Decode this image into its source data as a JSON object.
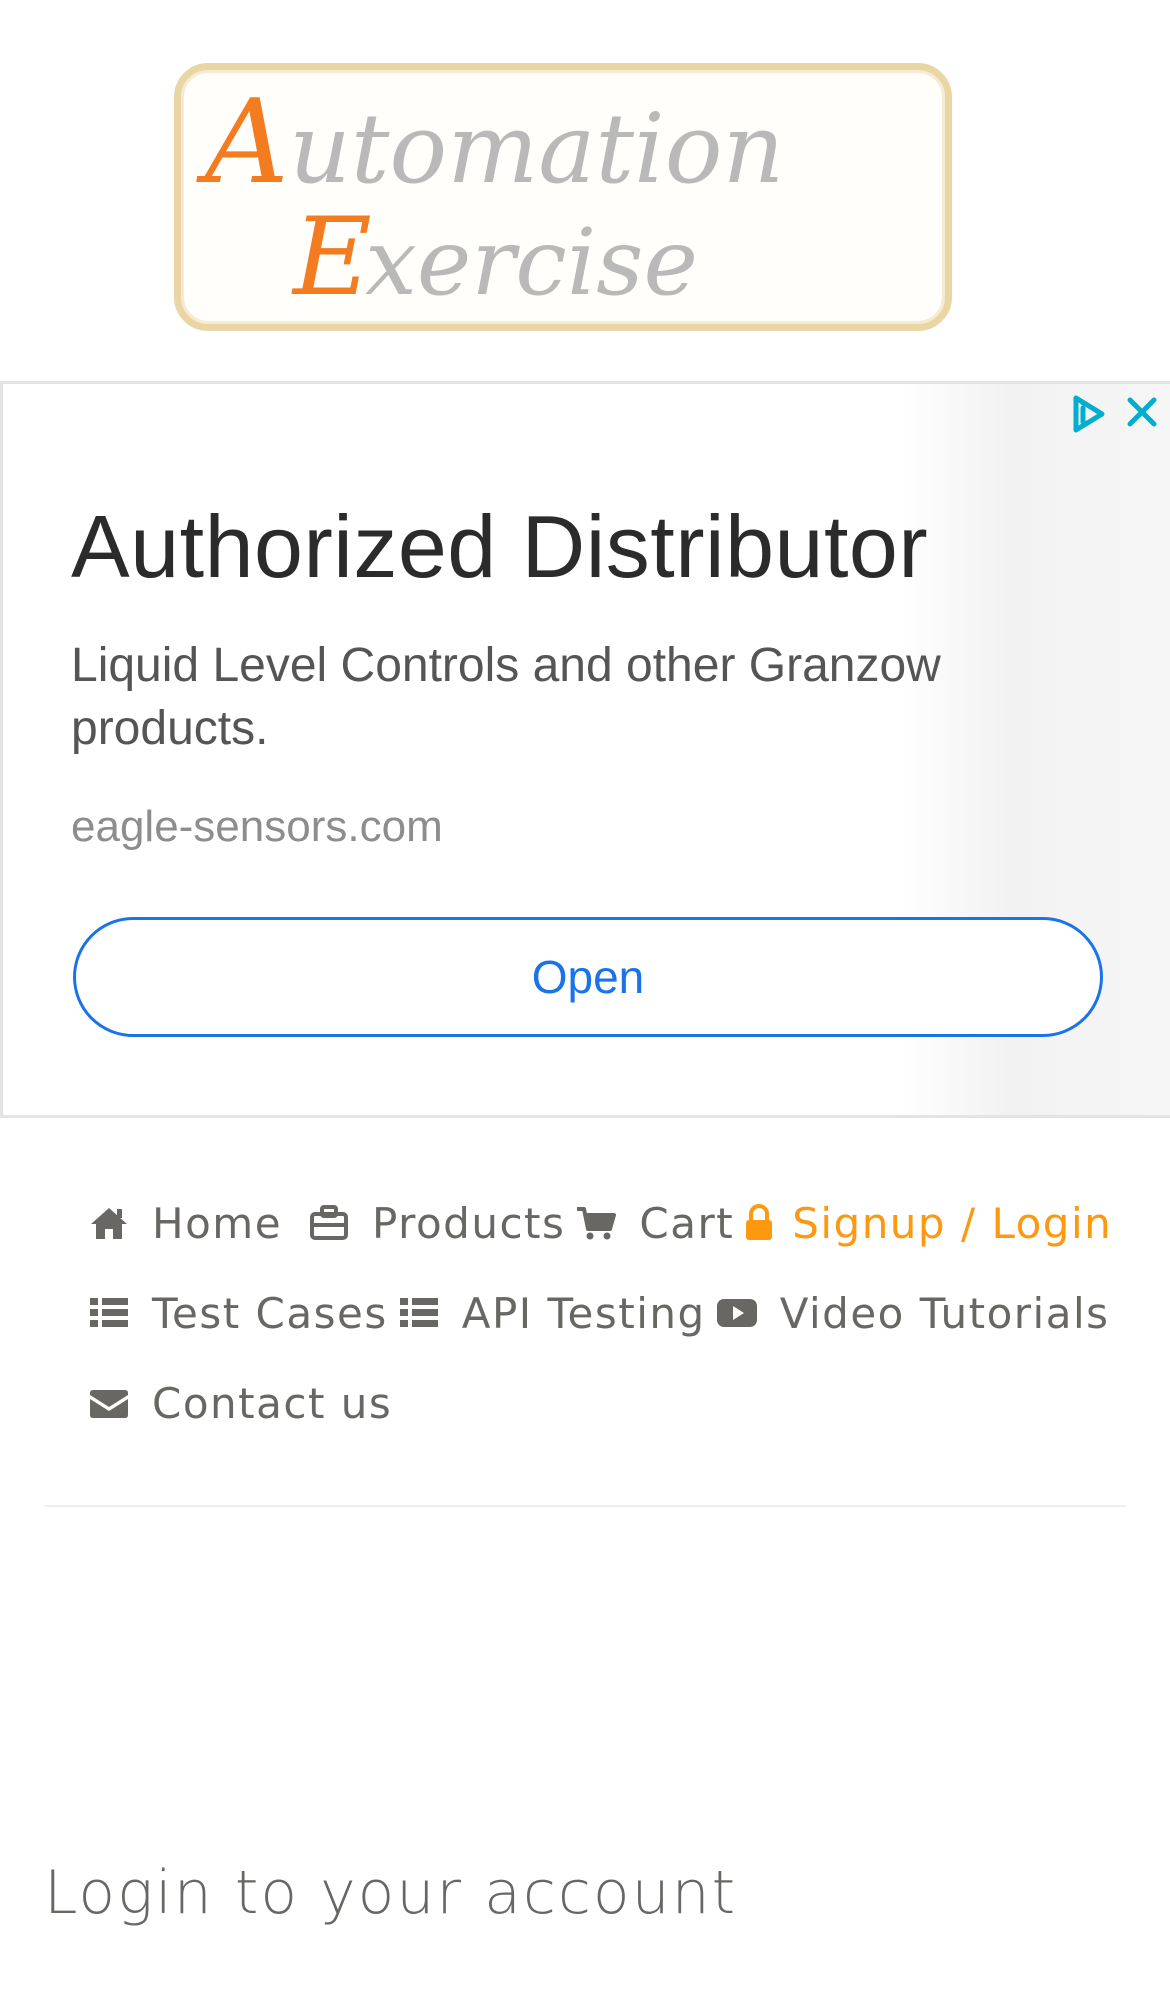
{
  "logo": {
    "line1": "Automation",
    "line2": "Exercise"
  },
  "ad": {
    "title": "Authorized Distributor",
    "description": "Liquid Level Controls and other Granzow products.",
    "domain": "eagle-sensors.com",
    "open_label": "Open",
    "choices_icon": "adchoices-icon",
    "close_icon": "close-icon"
  },
  "nav": {
    "items": [
      {
        "label": "Home",
        "icon": "home-icon"
      },
      {
        "label": "Products",
        "icon": "products-icon"
      },
      {
        "label": "Cart",
        "icon": "cart-icon"
      },
      {
        "label": "Signup / Login",
        "icon": "lock-icon",
        "active": true
      },
      {
        "label": "Test Cases",
        "icon": "list-icon"
      },
      {
        "label": "API Testing",
        "icon": "list-icon"
      },
      {
        "label": "Video Tutorials",
        "icon": "youtube-play-icon"
      },
      {
        "label": "Contact us",
        "icon": "envelope-icon"
      }
    ]
  },
  "login": {
    "title": "Login to your account"
  },
  "colors": {
    "accent": "#fe980f",
    "text": "#696763",
    "ad_blue": "#1a73e8",
    "logo_border": "#e9d6a4"
  }
}
